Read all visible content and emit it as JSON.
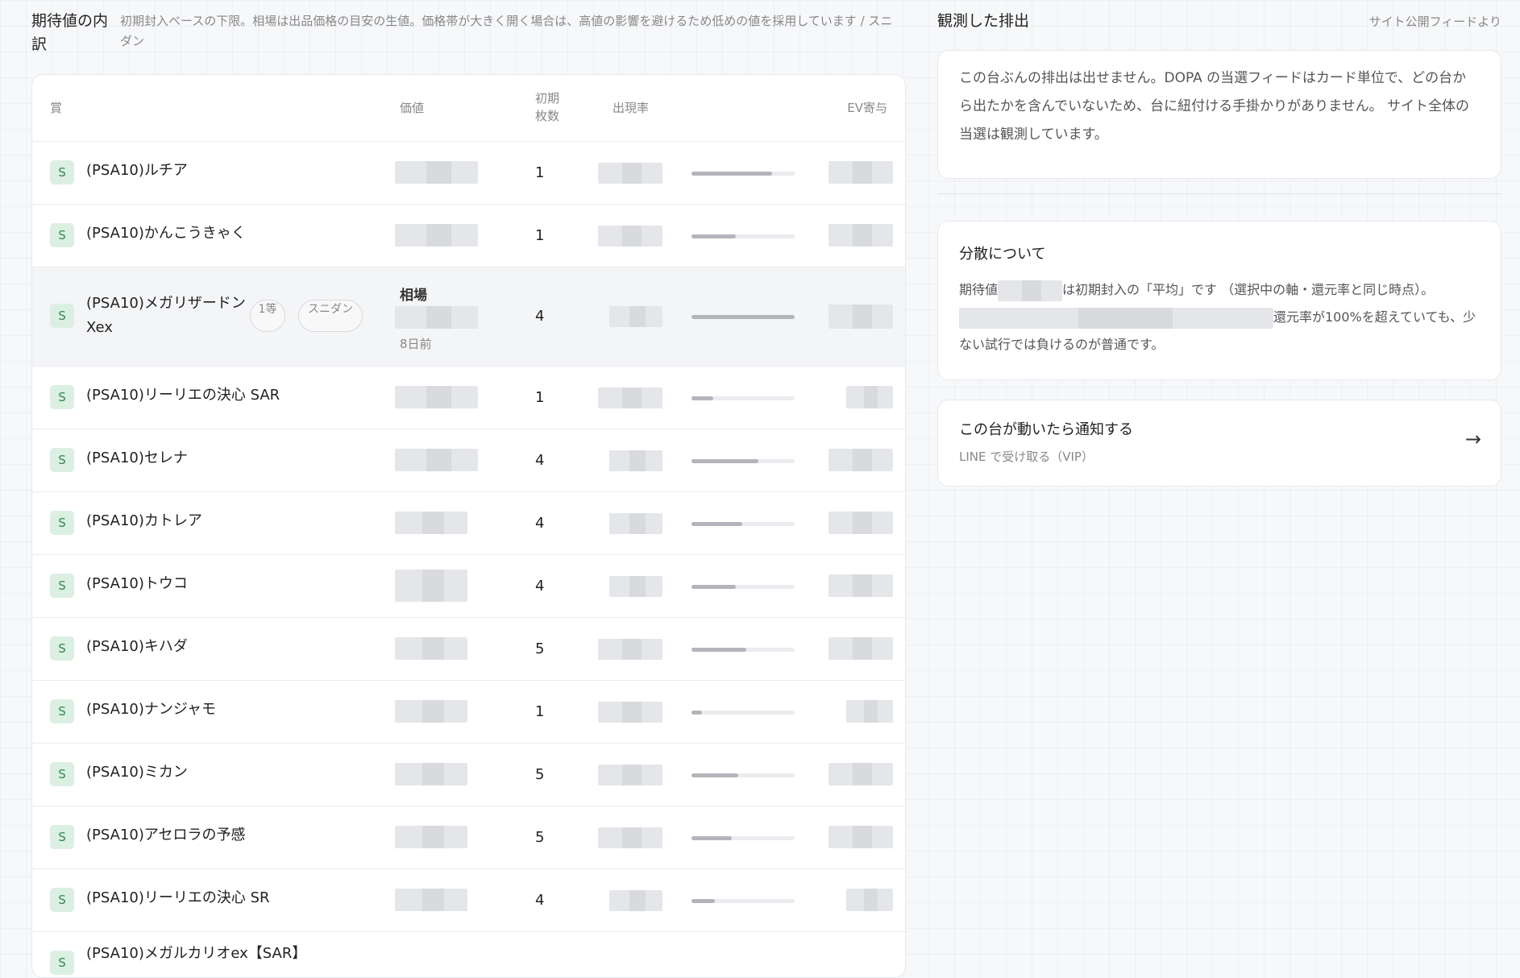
{
  "breakdown": {
    "title": "期待値の内訳",
    "note": "初期封入ベースの下限。相場は出品価格の目安の生値。価格帯が大きく開く場合は、高値の影響を避けるため低めの値を採用しています / スニダン"
  },
  "table": {
    "headers": {
      "prize": "賞",
      "value": "価値",
      "initial_count": "初期枚数",
      "rate": "出現率",
      "ev": "EV寄与"
    },
    "rows": [
      {
        "rank": "S",
        "name": "(PSA10)ルチア",
        "count": "1",
        "rate_bar": 0.78
      },
      {
        "rank": "S",
        "name": "(PSA10)かんこうきゃく",
        "count": "1",
        "rate_bar": 0.43
      },
      {
        "rank": "S",
        "name": "(PSA10)メガリザードンXex",
        "count": "4",
        "rate_bar": 1.0,
        "tag_rank": "1等",
        "tag_source": "スニダン",
        "market_label": "相場",
        "updated": "8日前"
      },
      {
        "rank": "S",
        "name": "(PSA10)リーリエの決心 SAR",
        "count": "1",
        "rate_bar": 0.21
      },
      {
        "rank": "S",
        "name": "(PSA10)セレナ",
        "count": "4",
        "rate_bar": 0.65
      },
      {
        "rank": "S",
        "name": "(PSA10)カトレア",
        "count": "4",
        "rate_bar": 0.49
      },
      {
        "rank": "S",
        "name": "(PSA10)トウコ",
        "count": "4",
        "rate_bar": 0.43
      },
      {
        "rank": "S",
        "name": "(PSA10)キハダ",
        "count": "5",
        "rate_bar": 0.53
      },
      {
        "rank": "S",
        "name": "(PSA10)ナンジャモ",
        "count": "1",
        "rate_bar": 0.1
      },
      {
        "rank": "S",
        "name": "(PSA10)ミカン",
        "count": "5",
        "rate_bar": 0.45
      },
      {
        "rank": "S",
        "name": "(PSA10)アセロラの予感",
        "count": "5",
        "rate_bar": 0.39
      },
      {
        "rank": "S",
        "name": "(PSA10)リーリエの決心 SR",
        "count": "4",
        "rate_bar": 0.23
      },
      {
        "rank": "S",
        "name": "(PSA10)メガルカリオex【SAR】",
        "count": "",
        "rate_bar": 0
      }
    ]
  },
  "observed": {
    "title": "観測した排出",
    "source": "サイト公開フィードより",
    "message": "この台ぶんの排出は出せません。DOPA の当選フィードはカード単位で、どの台から出たかを含んでいないため、台に紐付ける手掛かりがありません。 サイト全体の当選は観測しています。"
  },
  "variance": {
    "title": "分散について",
    "text_a": "期待値",
    "text_b": "は初期封入の「平均」です （選択中の軸・還元率と同じ時点）。",
    "text_c": "還元率が100%を超えていても、少ない試行では負けるのが普通です。"
  },
  "notify": {
    "title": "この台が動いたら通知する",
    "subtitle": "LINE で受け取る（VIP）",
    "arrow": "→"
  }
}
